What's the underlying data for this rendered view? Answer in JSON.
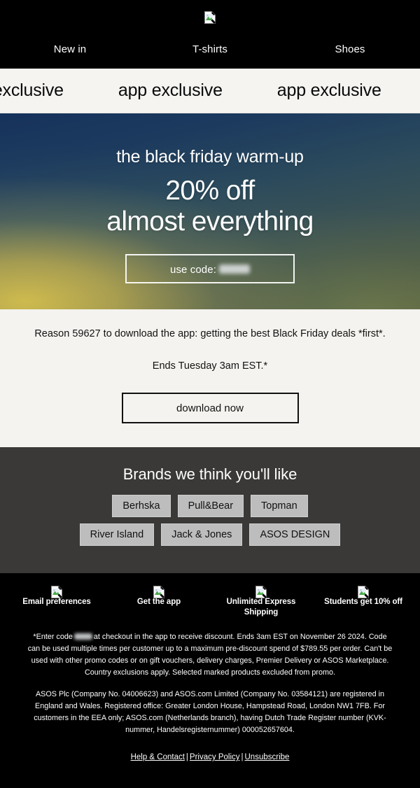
{
  "nav": {
    "logo_icon": "broken-image-icon",
    "links": [
      {
        "label": "New in"
      },
      {
        "label": "T-shirts"
      },
      {
        "label": "Shoes"
      }
    ]
  },
  "marquee": {
    "text": "app exclusive",
    "repeat_count": 4
  },
  "hero": {
    "kicker": "the black friday warm-up",
    "headline_line1": "20% off",
    "headline_line2": "almost everything",
    "code_label": "use code:",
    "code_value_redacted": true,
    "colors": {
      "gradient_top": "#16325c",
      "gradient_gold": "#d6c04d",
      "gradient_olive": "#5d6440",
      "text": "#ffffff"
    }
  },
  "promo": {
    "reason_line": "Reason 59627 to download the app: getting the best Black Friday deals *first*.",
    "ends_line": "Ends Tuesday 3am EST.*",
    "cta_label": "download now",
    "background": "#f4f3ef"
  },
  "brands": {
    "title": "Brands we think you'll like",
    "background": "#3a3937",
    "chip_color": "#bdbdbd",
    "row1": [
      {
        "label": "Berhska"
      },
      {
        "label": "Pull&Bear"
      },
      {
        "label": "Topman"
      }
    ],
    "row2": [
      {
        "label": "River Island"
      },
      {
        "label": "Jack & Jones"
      },
      {
        "label": "ASOS DESIGN"
      }
    ]
  },
  "footer": {
    "icon_links": [
      {
        "label": "Email preferences",
        "icon": "broken-image-icon"
      },
      {
        "label": "Get the app",
        "icon": "broken-image-icon"
      },
      {
        "label": "Unlimited Express Shipping",
        "icon": "broken-image-icon"
      },
      {
        "label": "Students get 10% off",
        "icon": "broken-image-icon"
      }
    ],
    "legal_1_before_code": "*Enter code",
    "legal_1_after_code": "at checkout in the app to receive discount. Ends 3am EST on November 26 2024. Code can be used multiple times per customer up to a maximum pre-discount spend of $789.55 per order. Can't be used with other promo codes or on gift vouchers, delivery charges, Premier Delivery or ASOS Marketplace. Country exclusions apply. Selected marked products excluded from promo.",
    "legal_2": "ASOS Plc (Company No. 04006623) and ASOS.com Limited (Company No. 03584121) are registered in England and Wales. Registered office: Greater London House, Hampstead Road, London NW1 7FB. For customers in the EEA only; ASOS.com (Netherlands branch), having Dutch Trade Register number (KVK-nummer, Handelsregisternummer) 000052657604.",
    "links": [
      {
        "label": "Help & Contact"
      },
      {
        "label": "Privacy Policy"
      },
      {
        "label": "Unsubscribe"
      }
    ],
    "link_separator": "|"
  }
}
